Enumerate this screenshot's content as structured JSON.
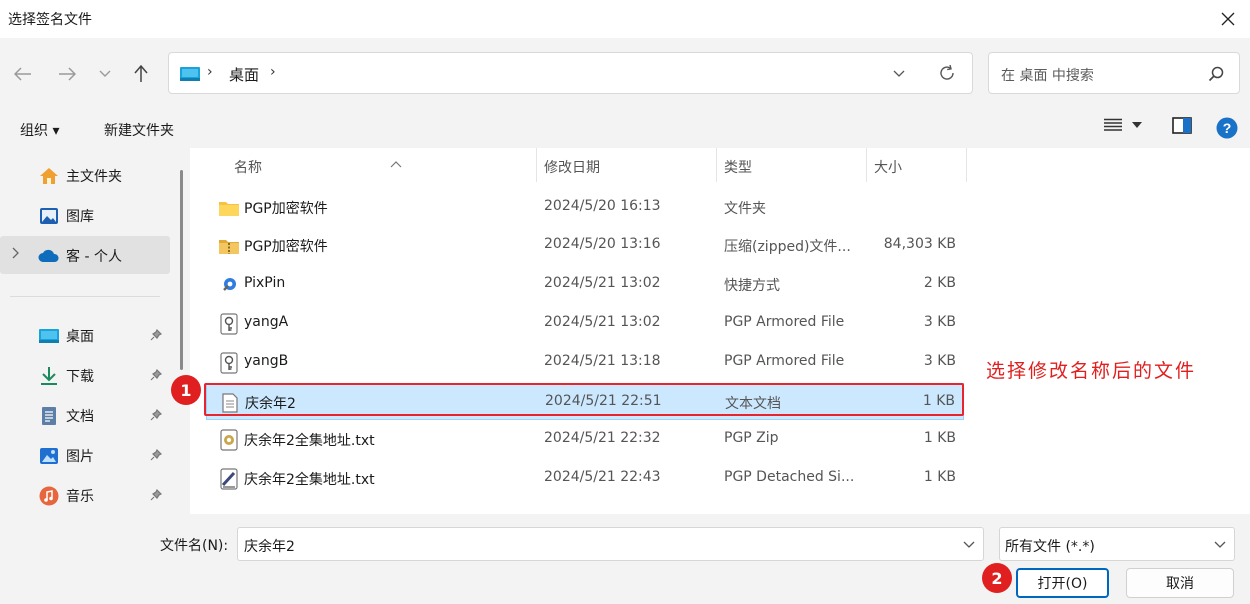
{
  "window": {
    "title": "选择签名文件"
  },
  "address": {
    "crumb": "桌面",
    "sep": "›"
  },
  "search": {
    "placeholder": "在 桌面 中搜索"
  },
  "toolbar": {
    "organize": "组织 ▾",
    "new_folder": "新建文件夹"
  },
  "sidebar": {
    "items": [
      {
        "label": "主文件夹",
        "icon": "home-icon"
      },
      {
        "label": "图库",
        "icon": "gallery-icon"
      },
      {
        "label": "客 - 个人",
        "icon": "cloud-icon"
      },
      {
        "label": "桌面",
        "icon": "desktop-icon"
      },
      {
        "label": "下载",
        "icon": "download-icon"
      },
      {
        "label": "文档",
        "icon": "document-icon"
      },
      {
        "label": "图片",
        "icon": "pictures-icon"
      },
      {
        "label": "音乐",
        "icon": "music-icon"
      }
    ]
  },
  "columns": {
    "name": "名称",
    "date": "修改日期",
    "type": "类型",
    "size": "大小"
  },
  "files": [
    {
      "name": "PGP加密软件",
      "date": "2024/5/20 16:13",
      "type": "文件夹",
      "size": "",
      "icon": "folder-icon"
    },
    {
      "name": "PGP加密软件",
      "date": "2024/5/20 13:16",
      "type": "压缩(zipped)文件...",
      "size": "84,303 KB",
      "icon": "zip-folder-icon"
    },
    {
      "name": "PixPin",
      "date": "2024/5/21 13:02",
      "type": "快捷方式",
      "size": "2 KB",
      "icon": "shortcut-icon"
    },
    {
      "name": "yangA",
      "date": "2024/5/21 13:02",
      "type": "PGP Armored File",
      "size": "3 KB",
      "icon": "pgp-key-icon"
    },
    {
      "name": "yangB",
      "date": "2024/5/21 13:18",
      "type": "PGP Armored File",
      "size": "3 KB",
      "icon": "pgp-key-icon"
    },
    {
      "name": "庆余年2",
      "date": "2024/5/21 22:51",
      "type": "文本文档",
      "size": "1 KB",
      "icon": "text-file-icon"
    },
    {
      "name": "庆余年2全集地址.txt",
      "date": "2024/5/21 22:32",
      "type": "PGP Zip",
      "size": "1 KB",
      "icon": "pgp-zip-icon"
    },
    {
      "name": "庆余年2全集地址.txt",
      "date": "2024/5/21 22:43",
      "type": "PGP Detached Si...",
      "size": "1 KB",
      "icon": "pgp-signature-icon"
    }
  ],
  "annotations": {
    "step1": "1",
    "step2": "2",
    "note": "选择修改名称后的文件"
  },
  "bottom": {
    "filename_label": "文件名(N):",
    "filename_value": "庆余年2",
    "filter_value": "所有文件 (*.*)",
    "open_label": "打开(O)",
    "cancel_label": "取消"
  },
  "colors": {
    "accent": "#0067c0",
    "selection": "#cce8ff",
    "annotation": "#e02020"
  }
}
